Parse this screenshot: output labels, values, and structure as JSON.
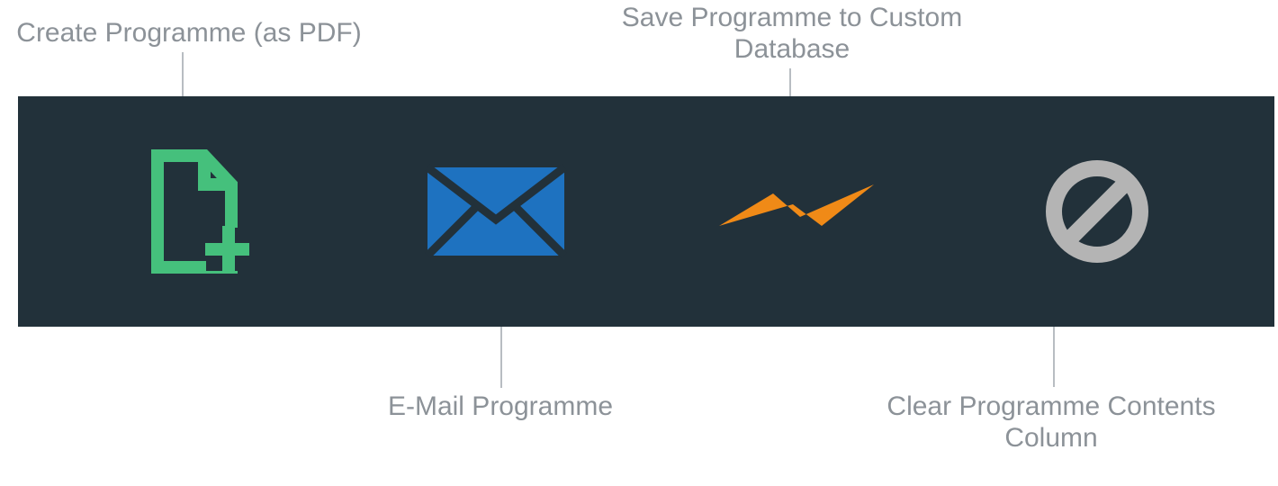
{
  "callouts": {
    "create_pdf": "Create Programme (as PDF)",
    "email": "E-Mail Programme",
    "save_db": "Save Programme to Custom Database",
    "clear": "Clear Programme Contents Column"
  },
  "icons": {
    "file_add": "file-add-icon",
    "envelope": "envelope-icon",
    "bolt": "bolt-icon",
    "prohibited": "prohibited-icon"
  },
  "colors": {
    "toolbar_bg": "#22313a",
    "label_text": "#8c9298",
    "leader": "#b8bdc2",
    "file_green": "#45c07c",
    "envelope_blue": "#1e72c0",
    "bolt_orange": "#f08a17",
    "prohibit_gray": "#b4b4b4"
  }
}
